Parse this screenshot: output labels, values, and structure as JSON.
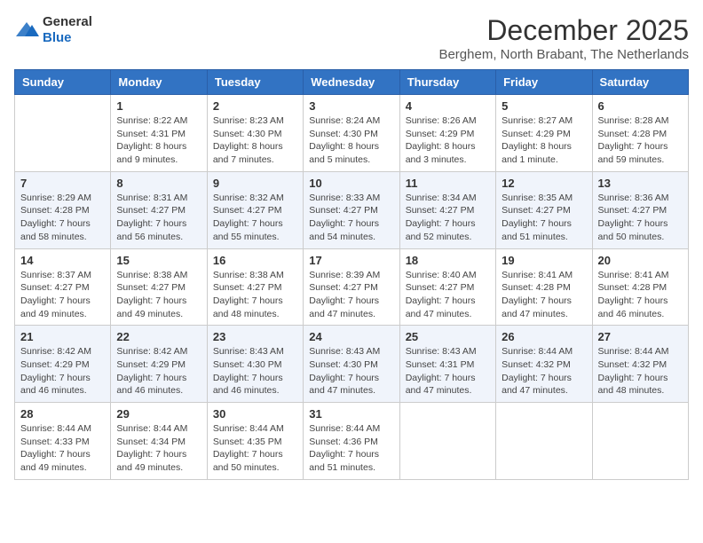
{
  "logo": {
    "general": "General",
    "blue": "Blue"
  },
  "header": {
    "month": "December 2025",
    "location": "Berghem, North Brabant, The Netherlands"
  },
  "weekdays": [
    "Sunday",
    "Monday",
    "Tuesday",
    "Wednesday",
    "Thursday",
    "Friday",
    "Saturday"
  ],
  "weeks": [
    [
      {
        "date": "",
        "info": ""
      },
      {
        "date": "1",
        "info": "Sunrise: 8:22 AM\nSunset: 4:31 PM\nDaylight: 8 hours\nand 9 minutes."
      },
      {
        "date": "2",
        "info": "Sunrise: 8:23 AM\nSunset: 4:30 PM\nDaylight: 8 hours\nand 7 minutes."
      },
      {
        "date": "3",
        "info": "Sunrise: 8:24 AM\nSunset: 4:30 PM\nDaylight: 8 hours\nand 5 minutes."
      },
      {
        "date": "4",
        "info": "Sunrise: 8:26 AM\nSunset: 4:29 PM\nDaylight: 8 hours\nand 3 minutes."
      },
      {
        "date": "5",
        "info": "Sunrise: 8:27 AM\nSunset: 4:29 PM\nDaylight: 8 hours\nand 1 minute."
      },
      {
        "date": "6",
        "info": "Sunrise: 8:28 AM\nSunset: 4:28 PM\nDaylight: 7 hours\nand 59 minutes."
      }
    ],
    [
      {
        "date": "7",
        "info": "Sunrise: 8:29 AM\nSunset: 4:28 PM\nDaylight: 7 hours\nand 58 minutes."
      },
      {
        "date": "8",
        "info": "Sunrise: 8:31 AM\nSunset: 4:27 PM\nDaylight: 7 hours\nand 56 minutes."
      },
      {
        "date": "9",
        "info": "Sunrise: 8:32 AM\nSunset: 4:27 PM\nDaylight: 7 hours\nand 55 minutes."
      },
      {
        "date": "10",
        "info": "Sunrise: 8:33 AM\nSunset: 4:27 PM\nDaylight: 7 hours\nand 54 minutes."
      },
      {
        "date": "11",
        "info": "Sunrise: 8:34 AM\nSunset: 4:27 PM\nDaylight: 7 hours\nand 52 minutes."
      },
      {
        "date": "12",
        "info": "Sunrise: 8:35 AM\nSunset: 4:27 PM\nDaylight: 7 hours\nand 51 minutes."
      },
      {
        "date": "13",
        "info": "Sunrise: 8:36 AM\nSunset: 4:27 PM\nDaylight: 7 hours\nand 50 minutes."
      }
    ],
    [
      {
        "date": "14",
        "info": "Sunrise: 8:37 AM\nSunset: 4:27 PM\nDaylight: 7 hours\nand 49 minutes."
      },
      {
        "date": "15",
        "info": "Sunrise: 8:38 AM\nSunset: 4:27 PM\nDaylight: 7 hours\nand 49 minutes."
      },
      {
        "date": "16",
        "info": "Sunrise: 8:38 AM\nSunset: 4:27 PM\nDaylight: 7 hours\nand 48 minutes."
      },
      {
        "date": "17",
        "info": "Sunrise: 8:39 AM\nSunset: 4:27 PM\nDaylight: 7 hours\nand 47 minutes."
      },
      {
        "date": "18",
        "info": "Sunrise: 8:40 AM\nSunset: 4:27 PM\nDaylight: 7 hours\nand 47 minutes."
      },
      {
        "date": "19",
        "info": "Sunrise: 8:41 AM\nSunset: 4:28 PM\nDaylight: 7 hours\nand 47 minutes."
      },
      {
        "date": "20",
        "info": "Sunrise: 8:41 AM\nSunset: 4:28 PM\nDaylight: 7 hours\nand 46 minutes."
      }
    ],
    [
      {
        "date": "21",
        "info": "Sunrise: 8:42 AM\nSunset: 4:29 PM\nDaylight: 7 hours\nand 46 minutes."
      },
      {
        "date": "22",
        "info": "Sunrise: 8:42 AM\nSunset: 4:29 PM\nDaylight: 7 hours\nand 46 minutes."
      },
      {
        "date": "23",
        "info": "Sunrise: 8:43 AM\nSunset: 4:30 PM\nDaylight: 7 hours\nand 46 minutes."
      },
      {
        "date": "24",
        "info": "Sunrise: 8:43 AM\nSunset: 4:30 PM\nDaylight: 7 hours\nand 47 minutes."
      },
      {
        "date": "25",
        "info": "Sunrise: 8:43 AM\nSunset: 4:31 PM\nDaylight: 7 hours\nand 47 minutes."
      },
      {
        "date": "26",
        "info": "Sunrise: 8:44 AM\nSunset: 4:32 PM\nDaylight: 7 hours\nand 47 minutes."
      },
      {
        "date": "27",
        "info": "Sunrise: 8:44 AM\nSunset: 4:32 PM\nDaylight: 7 hours\nand 48 minutes."
      }
    ],
    [
      {
        "date": "28",
        "info": "Sunrise: 8:44 AM\nSunset: 4:33 PM\nDaylight: 7 hours\nand 49 minutes."
      },
      {
        "date": "29",
        "info": "Sunrise: 8:44 AM\nSunset: 4:34 PM\nDaylight: 7 hours\nand 49 minutes."
      },
      {
        "date": "30",
        "info": "Sunrise: 8:44 AM\nSunset: 4:35 PM\nDaylight: 7 hours\nand 50 minutes."
      },
      {
        "date": "31",
        "info": "Sunrise: 8:44 AM\nSunset: 4:36 PM\nDaylight: 7 hours\nand 51 minutes."
      },
      {
        "date": "",
        "info": ""
      },
      {
        "date": "",
        "info": ""
      },
      {
        "date": "",
        "info": ""
      }
    ]
  ]
}
